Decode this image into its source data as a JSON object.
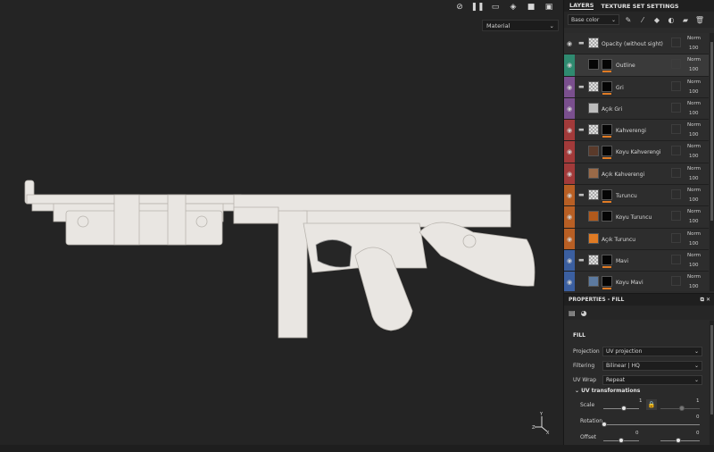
{
  "viewport": {
    "material_select": "Material",
    "toolbar": [
      {
        "icon": "hide-icon"
      },
      {
        "icon": "pause-icon"
      },
      {
        "icon": "camera-frame-icon"
      },
      {
        "icon": "cube-icon"
      },
      {
        "icon": "video-camera-icon"
      },
      {
        "icon": "screenshot-icon"
      }
    ]
  },
  "panel": {
    "tabs": [
      "LAYERS",
      "TEXTURE SET SETTINGS"
    ],
    "channel_select": "Base color"
  },
  "layers": [
    {
      "name": "Opacity (without sight)",
      "color": "#2d2d2d",
      "folder": true,
      "thumb": "checker",
      "mask": false,
      "visible": true,
      "underline": false,
      "blend": "Norm",
      "opacity": "100"
    },
    {
      "name": "Outline",
      "color": "#2f8a70",
      "folder": false,
      "thumb": "mask",
      "mask": true,
      "visible": true,
      "underline": true,
      "selected": true,
      "blend": "Norm",
      "opacity": "100"
    },
    {
      "name": "Gri",
      "color": "#7a4f8e",
      "folder": true,
      "thumb": "checker",
      "mask": true,
      "visible": true,
      "underline": true,
      "blend": "Norm",
      "opacity": "100"
    },
    {
      "name": "Açık Gri",
      "color": "#7a4f8e",
      "folder": false,
      "thumb": "grey",
      "mask": false,
      "visible": true,
      "underline": false,
      "blend": "Norm",
      "opacity": "100"
    },
    {
      "name": "Kahverengi",
      "color": "#a23a3a",
      "folder": true,
      "thumb": "checker",
      "mask": true,
      "visible": true,
      "underline": true,
      "blend": "Norm",
      "opacity": "100"
    },
    {
      "name": "Koyu Kahverengi",
      "color": "#a23a3a",
      "folder": false,
      "thumb": "brown-dark",
      "mask": true,
      "visible": true,
      "underline": true,
      "blend": "Norm",
      "opacity": "100"
    },
    {
      "name": "Açık Kahverengi",
      "color": "#a23a3a",
      "folder": false,
      "thumb": "brown-light",
      "mask": false,
      "visible": true,
      "underline": false,
      "blend": "Norm",
      "opacity": "100"
    },
    {
      "name": "Turuncu",
      "color": "#b85f24",
      "folder": true,
      "thumb": "checker",
      "mask": true,
      "visible": true,
      "underline": true,
      "blend": "Norm",
      "opacity": "100"
    },
    {
      "name": "Koyu Turuncu",
      "color": "#b85f24",
      "folder": false,
      "thumb": "orange-dark",
      "mask": true,
      "visible": true,
      "underline": false,
      "blend": "Norm",
      "opacity": "100"
    },
    {
      "name": "Açık Turuncu",
      "color": "#b85f24",
      "folder": false,
      "thumb": "orange-light",
      "mask": false,
      "visible": true,
      "underline": false,
      "blend": "Norm",
      "opacity": "100"
    },
    {
      "name": "Mavi",
      "color": "#3b5fa0",
      "folder": true,
      "thumb": "checker",
      "mask": true,
      "visible": true,
      "underline": true,
      "blend": "Norm",
      "opacity": "100"
    },
    {
      "name": "Koyu Mavi",
      "color": "#3b5fa0",
      "folder": false,
      "thumb": "blue-dark",
      "mask": true,
      "visible": true,
      "underline": true,
      "blend": "Norm",
      "opacity": "100"
    }
  ],
  "properties": {
    "header": "PROPERTIES - FILL",
    "fill_title": "FILL",
    "projection_label": "Projection",
    "projection_value": "UV projection",
    "filtering_label": "Filtering",
    "filtering_value": "Bilinear | HQ",
    "uvwrap_label": "UV Wrap",
    "uvwrap_value": "Repeat",
    "uv_title": "UV transformations",
    "scale_label": "Scale",
    "scale_value": "1",
    "scale_value_2": "1",
    "rotation_label": "Rotation",
    "rotation_value": "0",
    "offset_label": "Offset",
    "offset_value": "0",
    "offset_value_2": "0"
  },
  "colors": {
    "accent_orange": "#e07b24",
    "model": "#e9e6e2"
  }
}
